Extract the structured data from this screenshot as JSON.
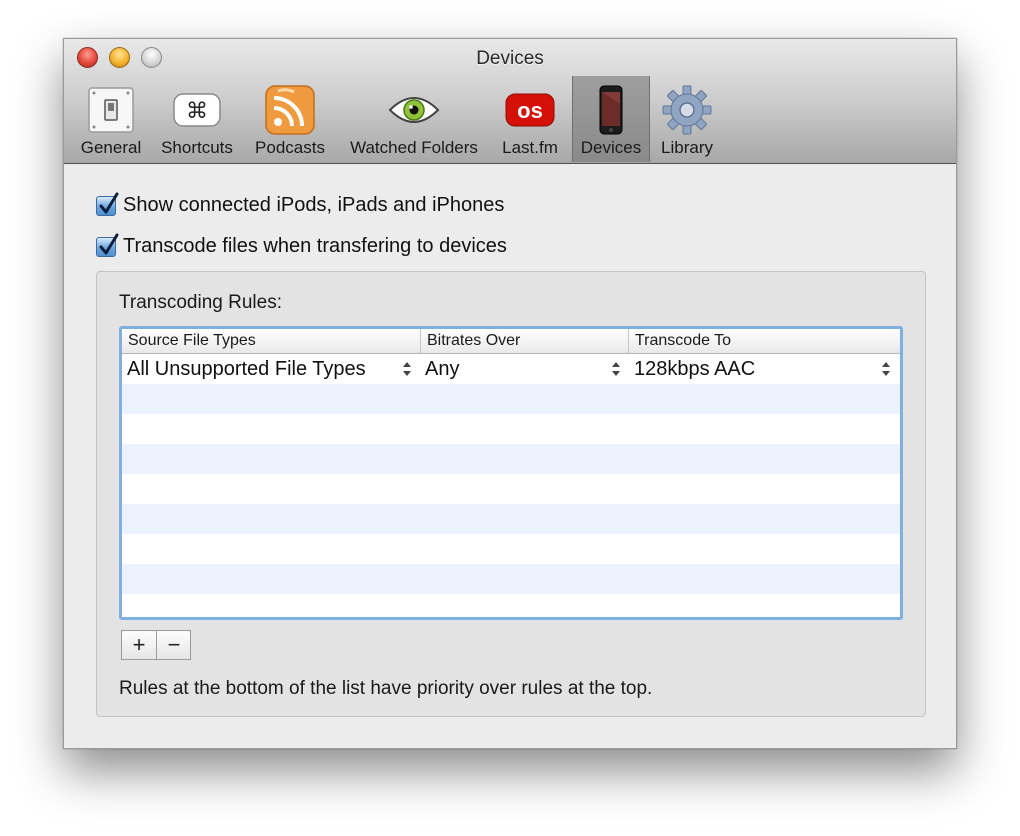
{
  "window": {
    "title": "Devices"
  },
  "toolbar": {
    "tabs": [
      {
        "label": "General",
        "icon": "switch-icon"
      },
      {
        "label": "Shortcuts",
        "icon": "command-key-icon"
      },
      {
        "label": "Podcasts",
        "icon": "podcast-icon"
      },
      {
        "label": "Watched Folders",
        "icon": "eye-icon"
      },
      {
        "label": "Last.fm",
        "icon": "lastfm-icon"
      },
      {
        "label": "Devices",
        "icon": "iphone-icon",
        "selected": true
      },
      {
        "label": "Library",
        "icon": "gear-icon"
      }
    ]
  },
  "options": {
    "show_devices": {
      "label": "Show connected iPods, iPads and iPhones",
      "checked": true
    },
    "transcode": {
      "label": "Transcode files when transfering to devices",
      "checked": true
    }
  },
  "rules": {
    "title": "Transcoding Rules:",
    "columns": [
      "Source File Types",
      "Bitrates Over",
      "Transcode To"
    ],
    "rows": [
      {
        "source": "All Unsupported File Types",
        "bitrate": "Any",
        "target": "128kbps AAC"
      }
    ],
    "add_label": "+",
    "remove_label": "−",
    "footnote": "Rules at the bottom of the list have priority over rules at the top."
  },
  "colors": {
    "selection_border": "#7fb0e2",
    "alt_row": "#edf3fe",
    "checkbox_blue": "#6ba7de"
  }
}
